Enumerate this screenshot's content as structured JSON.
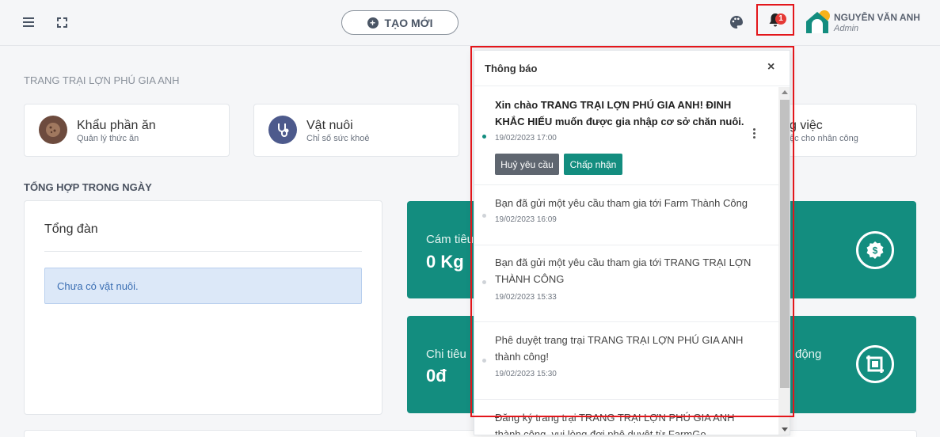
{
  "header": {
    "create_label": "TẠO MỚI",
    "notification_count": "1",
    "user_name": "NGUYỄN VĂN ANH",
    "user_role": "Admin"
  },
  "farm_name": "TRANG TRẠI LỢN PHÚ GIA ANH",
  "features": [
    {
      "title": "Khẩu phần ăn",
      "subtitle": "Quản lý thức ăn",
      "icon": "cookie-icon",
      "color": "#6d4b3e"
    },
    {
      "title": "Vật nuôi",
      "subtitle": "Chỉ số sức khoẻ",
      "icon": "stethoscope-icon",
      "color": "#4d5a8c"
    },
    {
      "title": "g việc",
      "subtitle": "ệc cho nhân công",
      "icon": "tasks-icon",
      "color": "#138d7f"
    }
  ],
  "daily_summary": {
    "title": "TỔNG HỢP TRONG NGÀY",
    "herd": {
      "title": "Tổng đàn",
      "empty_message": "Chưa có vật nuôi."
    },
    "stats": [
      {
        "label": "Cám tiêu",
        "value": "0 Kg",
        "icon": "dollar-badge-icon"
      },
      {
        "label": "Chi tiêu",
        "value": "0đ",
        "right_label": "động",
        "icon": "crop-frame-icon"
      }
    ]
  },
  "notifications": {
    "title": "Thông báo",
    "close_label": "×",
    "items": [
      {
        "text": "Xin chào TRANG TRẠI LỢN PHÚ GIA ANH! ĐINH KHẮC HIẾU muốn được gia nhập cơ sở chăn nuôi.",
        "time": "19/02/2023 17:00",
        "unread": true,
        "cancel_label": "Huỷ yêu cầu",
        "accept_label": "Chấp nhận"
      },
      {
        "text": "Bạn đã gửi một yêu cầu tham gia tới Farm Thành Công",
        "time": "19/02/2023 16:09",
        "unread": false
      },
      {
        "text": "Bạn đã gửi một yêu cầu tham gia tới TRANG TRẠI LỢN THÀNH CÔNG",
        "time": "19/02/2023 15:33",
        "unread": false
      },
      {
        "text": "Phê duyệt trang trại TRANG TRẠI LỢN PHÚ GIA ANH thành công!",
        "time": "19/02/2023 15:30",
        "unread": false
      },
      {
        "text": "Đăng ký trang trại TRANG TRẠI LỢN PHÚ GIA ANH thành công, vui lòng đợi phê duyệt từ FarmGo",
        "time": "",
        "unread": false
      }
    ]
  },
  "colors": {
    "accent": "#138d7f",
    "highlight_frame": "#e3161b",
    "badge": "#e53935"
  }
}
